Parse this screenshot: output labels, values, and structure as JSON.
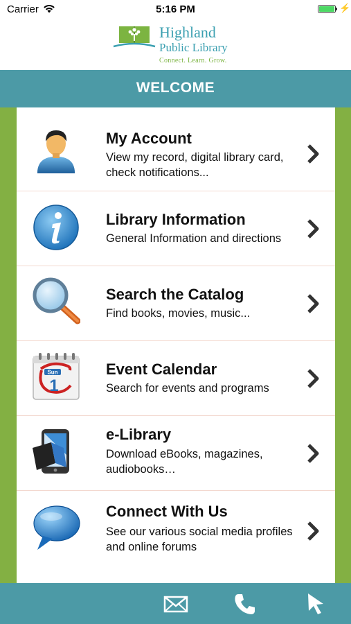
{
  "status_bar": {
    "carrier": "Carrier",
    "time": "5:16 PM",
    "battery_level": 1.0
  },
  "logo": {
    "line1": "Highland",
    "line2": "Public Library",
    "tagline": "Connect. Learn. Grow."
  },
  "header": {
    "title": "WELCOME"
  },
  "menu": [
    {
      "title": "My Account",
      "description": "View my record, digital library card, check notifications...",
      "icon": "user-avatar-icon"
    },
    {
      "title": "Library Information",
      "description": "General Information and directions",
      "icon": "info-icon"
    },
    {
      "title": "Search the Catalog",
      "description": "Find books, movies, music...",
      "icon": "magnifier-icon"
    },
    {
      "title": "Event Calendar",
      "description": "Search for events and programs",
      "icon": "calendar-icon",
      "calendar_label": "Sun",
      "calendar_day": "1"
    },
    {
      "title": "e-Library",
      "description": "Download eBooks, magazines, audiobooks…",
      "icon": "tablet-book-icon"
    },
    {
      "title": "Connect With Us",
      "description": "See our various social media profiles and online forums",
      "icon": "speech-bubble-icon"
    }
  ],
  "bottom_bar": [
    {
      "icon": "envelope-icon",
      "action": "email"
    },
    {
      "icon": "phone-icon",
      "action": "call"
    },
    {
      "icon": "cursor-arrow-icon",
      "action": "directions"
    }
  ],
  "colors": {
    "teal": "#4c9aa6",
    "green": "#83b043",
    "logo_blue": "#3a9fb0",
    "logo_green": "#7cb441",
    "divider": "#f3d8cf"
  }
}
